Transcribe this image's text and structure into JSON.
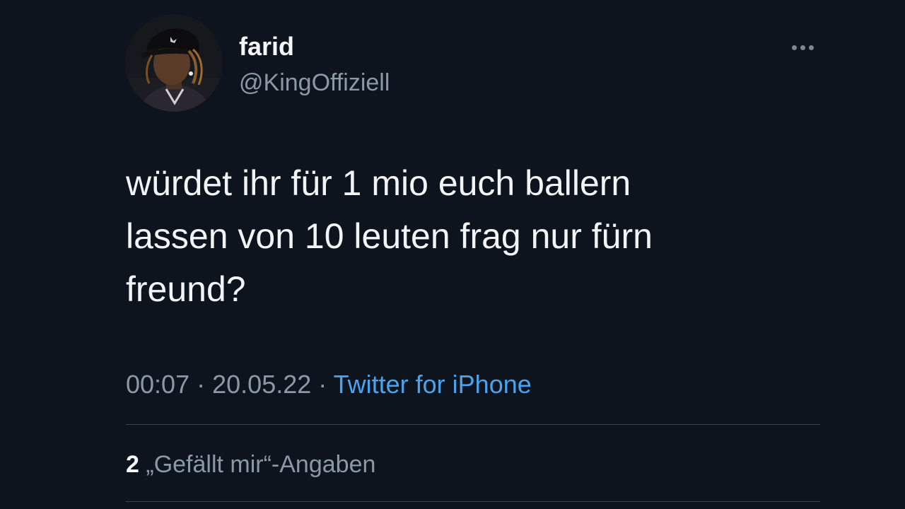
{
  "author": {
    "display_name": "farid",
    "handle": "@KingOffiziell"
  },
  "tweet": {
    "text": "würdet ihr für 1 mio euch ballern\nlassen von 10 leuten frag nur fürn\nfreund?",
    "time": "00:07",
    "separator": "·",
    "date": "20.05.22",
    "source": "Twitter for iPhone"
  },
  "stats": {
    "likes_count": "2",
    "likes_label": "„Gefällt mir“-Angaben"
  },
  "icons": {
    "more": "more-horizontal-icon"
  },
  "colors": {
    "background": "#0d141e",
    "accent": "#4aa3ec",
    "secondary_text": "#8b98a5",
    "divider": "#38444d"
  }
}
